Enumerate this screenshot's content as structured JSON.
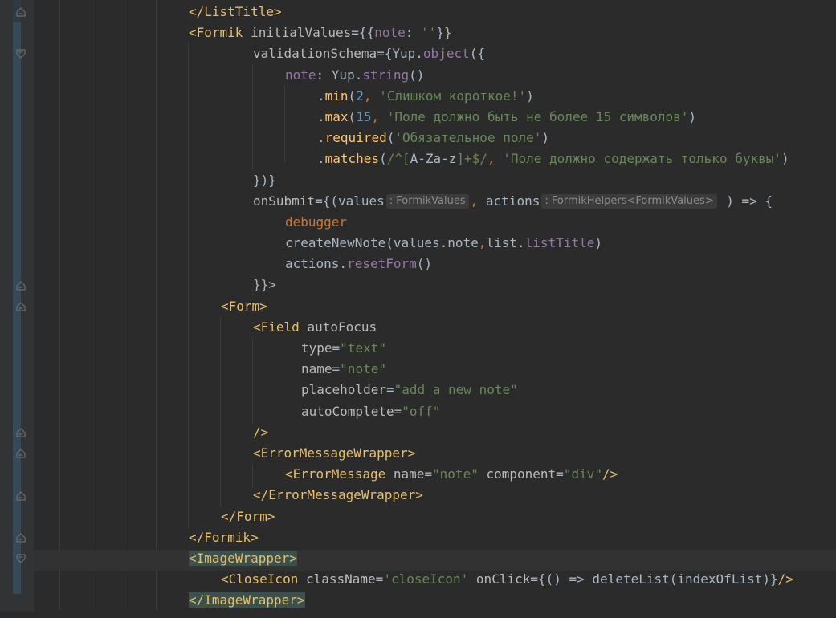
{
  "editor": {
    "colors": {
      "background": "#2b2b2b",
      "gutter": "#313335",
      "tag": "#e8bf6a",
      "string": "#6a8759",
      "number": "#6897bb",
      "keyword": "#cc7832",
      "property": "#9876aa",
      "function": "#ffc66d",
      "plain": "#a9b7c6"
    },
    "lines": [
      {
        "indent": 0,
        "tokens": [
          [
            "tag",
            "</ListTitle>"
          ]
        ]
      },
      {
        "indent": 0,
        "tokens": [
          [
            "tag",
            "<Formik "
          ],
          [
            "attr",
            "initialValues"
          ],
          [
            "plain",
            "={{"
          ],
          [
            "prop",
            "note"
          ],
          [
            "plain",
            ": "
          ],
          [
            "str",
            "''"
          ],
          [
            "plain",
            "}}"
          ]
        ]
      },
      {
        "indent": 2,
        "tokens": [
          [
            "attr",
            "validationSchema"
          ],
          [
            "plain",
            "={"
          ],
          [
            "plain",
            "Yup."
          ],
          [
            "prop",
            "object"
          ],
          [
            "plain",
            "({"
          ]
        ]
      },
      {
        "indent": 3,
        "tokens": [
          [
            "prop",
            "note"
          ],
          [
            "plain",
            ": Yup."
          ],
          [
            "prop",
            "string"
          ],
          [
            "plain",
            "()"
          ]
        ]
      },
      {
        "indent": 4,
        "tokens": [
          [
            "plain",
            "."
          ],
          [
            "fn",
            "min"
          ],
          [
            "plain",
            "("
          ],
          [
            "num",
            "2"
          ],
          [
            "punc",
            ", "
          ],
          [
            "str",
            "'Слишком короткое!'"
          ],
          [
            "plain",
            ")"
          ]
        ]
      },
      {
        "indent": 4,
        "tokens": [
          [
            "plain",
            "."
          ],
          [
            "fn",
            "max"
          ],
          [
            "plain",
            "("
          ],
          [
            "num",
            "15"
          ],
          [
            "punc",
            ", "
          ],
          [
            "str",
            "'Поле должно быть не более 15 символов'"
          ],
          [
            "plain",
            ")"
          ]
        ]
      },
      {
        "indent": 4,
        "tokens": [
          [
            "plain",
            "."
          ],
          [
            "fn",
            "required"
          ],
          [
            "plain",
            "("
          ],
          [
            "str",
            "'Обязательное поле'"
          ],
          [
            "plain",
            ")"
          ]
        ]
      },
      {
        "indent": 4,
        "tokens": [
          [
            "plain",
            "."
          ],
          [
            "fn",
            "matches"
          ],
          [
            "plain",
            "("
          ],
          [
            "str",
            "/^["
          ],
          [
            "plain",
            "A-Za-z"
          ],
          [
            "str",
            "]+$/"
          ],
          [
            "punc",
            ", "
          ],
          [
            "str",
            "'Поле должно содержать только буквы'"
          ],
          [
            "plain",
            ")"
          ]
        ]
      },
      {
        "indent": 2,
        "tokens": [
          [
            "plain",
            "})}"
          ]
        ]
      },
      {
        "indent": 2,
        "tokens": [
          [
            "attr",
            "onSubmit"
          ],
          [
            "plain",
            "={(values"
          ],
          [
            "hint",
            ": FormikValues"
          ],
          [
            "punc",
            ", "
          ],
          [
            "plain",
            "actions"
          ],
          [
            "hint",
            ": FormikHelpers<FormikValues>"
          ],
          [
            "plain",
            " ) => {"
          ]
        ]
      },
      {
        "indent": 3,
        "tokens": [
          [
            "kw",
            "debugger"
          ]
        ]
      },
      {
        "indent": 3,
        "tokens": [
          [
            "plain",
            "createNewNote(values.note"
          ],
          [
            "punc",
            ","
          ],
          [
            "plain",
            "list."
          ],
          [
            "prop",
            "listTitle"
          ],
          [
            "plain",
            ")"
          ]
        ]
      },
      {
        "indent": 3,
        "tokens": [
          [
            "plain",
            "actions."
          ],
          [
            "prop",
            "resetForm"
          ],
          [
            "plain",
            "()"
          ]
        ]
      },
      {
        "indent": 2,
        "tokens": [
          [
            "plain",
            "}}>"
          ]
        ]
      },
      {
        "indent": 1,
        "tokens": [
          [
            "tag",
            "<Form>"
          ]
        ]
      },
      {
        "indent": 2,
        "tokens": [
          [
            "tag",
            "<Field "
          ],
          [
            "attr",
            "autoFocus"
          ]
        ]
      },
      {
        "indent": 3.5,
        "tokens": [
          [
            "attr",
            "type"
          ],
          [
            "plain",
            "="
          ],
          [
            "str",
            "\"text\""
          ]
        ]
      },
      {
        "indent": 3.5,
        "tokens": [
          [
            "attr",
            "name"
          ],
          [
            "plain",
            "="
          ],
          [
            "str",
            "\"note\""
          ]
        ]
      },
      {
        "indent": 3.5,
        "tokens": [
          [
            "attr",
            "placeholder"
          ],
          [
            "plain",
            "="
          ],
          [
            "str",
            "\"add a new note\""
          ]
        ]
      },
      {
        "indent": 3.5,
        "tokens": [
          [
            "attr",
            "autoComplete"
          ],
          [
            "plain",
            "="
          ],
          [
            "str",
            "\"off\""
          ]
        ]
      },
      {
        "indent": 2,
        "tokens": [
          [
            "tag",
            "/>"
          ]
        ]
      },
      {
        "indent": 2,
        "tokens": [
          [
            "tag",
            "<ErrorMessageWrapper>"
          ]
        ]
      },
      {
        "indent": 3,
        "tokens": [
          [
            "tag",
            "<ErrorMessage "
          ],
          [
            "attr",
            "name"
          ],
          [
            "plain",
            "="
          ],
          [
            "str",
            "\"note\""
          ],
          [
            "plain",
            " "
          ],
          [
            "attr",
            "component"
          ],
          [
            "plain",
            "="
          ],
          [
            "str",
            "\"div\""
          ],
          [
            "tag",
            "/>"
          ]
        ]
      },
      {
        "indent": 2,
        "tokens": [
          [
            "tag",
            "</ErrorMessageWrapper>"
          ]
        ]
      },
      {
        "indent": 1,
        "tokens": [
          [
            "tag",
            "</Form>"
          ]
        ]
      },
      {
        "indent": 0,
        "tokens": [
          [
            "tag",
            "</Formik>"
          ]
        ]
      },
      {
        "indent": 0,
        "tokens": [
          [
            "hltag",
            "<ImageWrapper>"
          ]
        ]
      },
      {
        "indent": 1,
        "tokens": [
          [
            "tag",
            "<CloseIcon "
          ],
          [
            "attr",
            "className"
          ],
          [
            "plain",
            "="
          ],
          [
            "str",
            "'closeIcon'"
          ],
          [
            "plain",
            " "
          ],
          [
            "attr",
            "onClick"
          ],
          [
            "plain",
            "={() => deleteList(indexOfList)}"
          ],
          [
            "tag",
            "/>"
          ]
        ]
      },
      {
        "indent": 0,
        "tokens": [
          [
            "hltag",
            "</ImageWrapper>"
          ]
        ]
      }
    ]
  }
}
